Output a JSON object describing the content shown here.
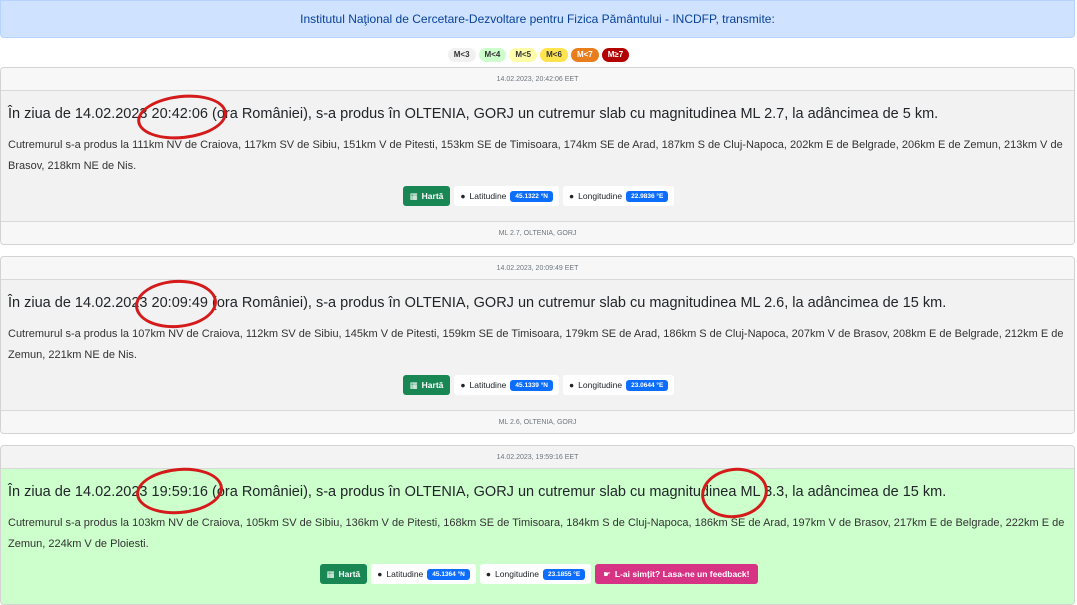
{
  "banner": "Institutul Naţional de Cercetare-Dezvoltare pentru Fizica Pământului - INCDFP, transmite:",
  "legend": [
    {
      "label": "M<3",
      "bg": "#f1f1f1",
      "fg": "#333333"
    },
    {
      "label": "M<4",
      "bg": "#ccffcc",
      "fg": "#333333"
    },
    {
      "label": "M<5",
      "bg": "#ffffaa",
      "fg": "#333333"
    },
    {
      "label": "M<6",
      "bg": "#ffe44d",
      "fg": "#333333"
    },
    {
      "label": "M<7",
      "bg": "#e87d1e",
      "fg": "#ffffff"
    },
    {
      "label": "M≥7",
      "bg": "#b30000",
      "fg": "#ffffff"
    }
  ],
  "quakes": [
    {
      "timestamp": "14.02.2023, 20:42:06 EET",
      "pre": "În ziua de ",
      "date": "14.02.2023",
      "time": "20:42:06",
      "mid1": " (ora României), s-a produs în ",
      "region": "OLTENIA, GORJ",
      "mid2": " un cutremur slab cu magnitudinea ",
      "magnitude": "ML 2.7",
      "mid3": ", la adâncimea de ",
      "depth": "5 km",
      "end": ".",
      "description": "Cutremurul s-a produs la 111km NV de Craiova, 117km SV de Sibiu, 151km V de Pitesti, 153km SE de Timisoara, 174km SE de Arad, 187km S de Cluj-Napoca, 202km E de Belgrade, 206km E de Zemun, 213km V de Brasov, 218km NE de Nis.",
      "map_label": "Hartă",
      "lat_label": "Latitudine",
      "lat": "45.1322 °N",
      "lon_label": "Longitudine",
      "lon": "22.9836 °E",
      "footer": "ML 2.7, OLTENIA, GORJ"
    },
    {
      "timestamp": "14.02.2023, 20:09:49 EET",
      "pre": "În ziua de ",
      "date": "14.02.2023",
      "time": "20:09:49",
      "mid1": " (ora României), s-a produs în ",
      "region": "OLTENIA, GORJ",
      "mid2": " un cutremur slab cu magnitudinea ",
      "magnitude": "ML 2.6",
      "mid3": ", la adâncimea de ",
      "depth": "15 km",
      "end": ".",
      "description": "Cutremurul s-a produs la 107km NV de Craiova, 112km SV de Sibiu, 145km V de Pitesti, 159km SE de Timisoara, 179km SE de Arad, 186km S de Cluj-Napoca, 207km V de Brasov, 208km E de Belgrade, 212km E de Zemun, 221km NE de Nis.",
      "map_label": "Hartă",
      "lat_label": "Latitudine",
      "lat": "45.1339 °N",
      "lon_label": "Longitudine",
      "lon": "23.0644 °E",
      "footer": "ML 2.6, OLTENIA, GORJ"
    },
    {
      "timestamp": "14.02.2023, 19:59:16 EET",
      "pre": "În ziua de ",
      "date": "14.02.2023",
      "time": "19:59:16",
      "mid1": " (ora României), s-a produs în ",
      "region": "OLTENIA, GORJ",
      "mid2": " un cutremur slab cu magnitudinea ",
      "magnitude": "ML 3.3",
      "mid3": ", la adâncimea de ",
      "depth": "15 km",
      "end": ".",
      "description": "Cutremurul s-a produs la 103km NV de Craiova, 105km SV de Sibiu, 136km V de Pitesti, 168km SE de Timisoara, 184km S de Cluj-Napoca, 186km SE de Arad, 197km V de Brasov, 217km E de Belgrade, 222km E de Zemun, 224km V de Ploiesti.",
      "map_label": "Hartă",
      "lat_label": "Latitudine",
      "lat": "45.1364 °N",
      "lon_label": "Longitudine",
      "lon": "23.1855 °E",
      "feedback": "L-ai simțit? Lasa-ne un feedback!"
    }
  ],
  "colors": {
    "card_default": "#f2f2f2",
    "card_m4": "#ccffcc",
    "map_button": "#198754",
    "coord_badge": "#0d6efd",
    "feedback_button": "#d63384",
    "annotation_circle": "#d41a1a"
  }
}
